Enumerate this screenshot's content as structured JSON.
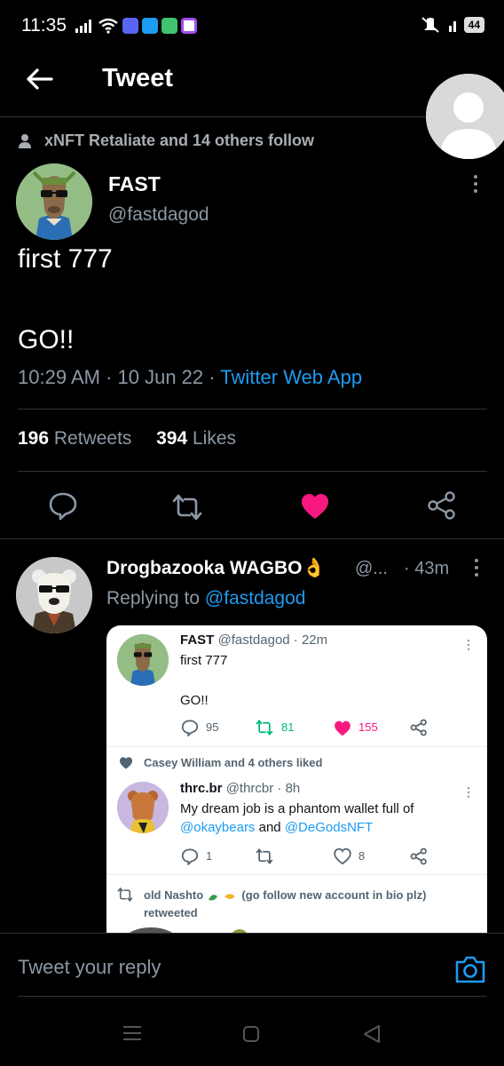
{
  "status_bar": {
    "time": "11:35",
    "battery": "44",
    "apps": [
      "discord-icon",
      "twitter-icon",
      "phone-app-icon",
      "messenger-icon"
    ]
  },
  "header": {
    "title": "Tweet"
  },
  "social_context": "xNFT Retaliate and 14 others follow",
  "tweet": {
    "name": "FAST",
    "handle": "@fastdagod",
    "line1": "first 777",
    "line2": "GO!!",
    "time_date": "10:29 AM · 10 Jun 22 · ",
    "source": "Twitter Web App",
    "retweets_count": "196",
    "retweets_label": " Retweets",
    "likes_count": "394",
    "likes_label": " Likes"
  },
  "reply": {
    "name": "Drogbazooka WAGBO👌",
    "handle": "@...",
    "time": "· 43m",
    "replying_prefix": "Replying to ",
    "replying_to": "@fastdagod"
  },
  "embedded": {
    "tweet": {
      "name": "FAST",
      "handle_time": "@fastdagod · 22m",
      "line1": "first 777",
      "line2": "GO!!",
      "replies": "95",
      "retweets": "81",
      "likes": "155"
    },
    "liked_context": "Casey William and 4 others liked",
    "tweet2": {
      "name": "thrc.br",
      "handle_time": "@thrcbr · 8h",
      "text1": "My dream job is a phantom wallet full of",
      "link1": "@okaybears",
      "and": " and ",
      "link2": "@DeGodsNFT",
      "replies": "1",
      "likes": "8"
    },
    "retweet_context": "old Nashto",
    "retweet_context2": "(go follow new account in bio plz)",
    "retweet_context3": "retweeted"
  },
  "reply_bar": {
    "placeholder": "Tweet your reply"
  },
  "colors": {
    "accent": "#1d9bf0",
    "like": "#f91880",
    "background": "#000000"
  }
}
